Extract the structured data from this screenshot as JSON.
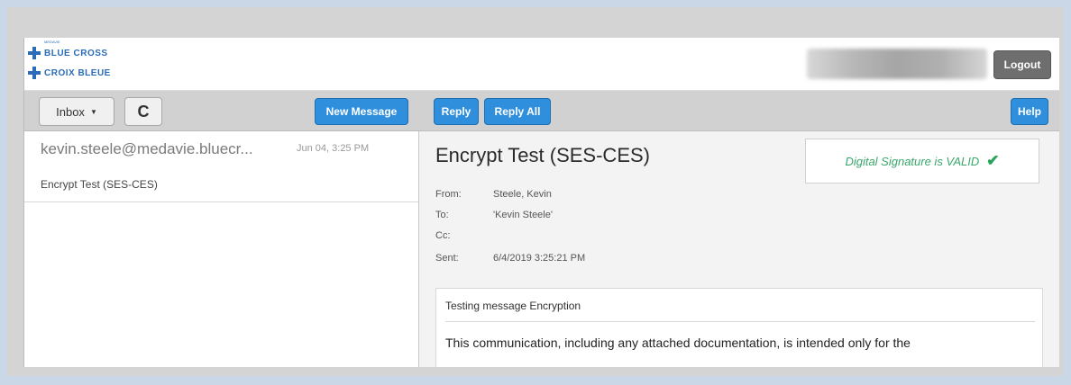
{
  "header": {
    "logo_small": "MEDAVIE",
    "logo_line1": "BLUE CROSS",
    "logo_line2": "CROIX BLEUE",
    "logout_label": "Logout"
  },
  "toolbar": {
    "inbox_label": "Inbox",
    "refresh_glyph": "C",
    "new_message_label": "New Message",
    "reply_label": "Reply",
    "reply_all_label": "Reply All",
    "help_label": "Help"
  },
  "message_list": [
    {
      "from": "kevin.steele@medavie.bluecr...",
      "date": "Jun 04, 3:25 PM",
      "subject": "Encrypt Test (SES-CES)"
    }
  ],
  "message": {
    "subject": "Encrypt Test (SES-CES)",
    "signature_status": "Digital Signature is VALID",
    "signature_icon": "check-icon",
    "from_label": "From:",
    "from_value": "Steele, Kevin",
    "to_label": "To:",
    "to_value": "'Kevin Steele'",
    "cc_label": "Cc:",
    "cc_value": "",
    "sent_label": "Sent:",
    "sent_value": "6/4/2019 3:25:21 PM",
    "body_first_line": "Testing message Encryption",
    "body_text": "This communication, including any attached documentation, is intended only for the"
  },
  "colors": {
    "brand_blue": "#2a6cb8",
    "button_blue": "#2f8fdd",
    "valid_green": "#3aa86b"
  }
}
